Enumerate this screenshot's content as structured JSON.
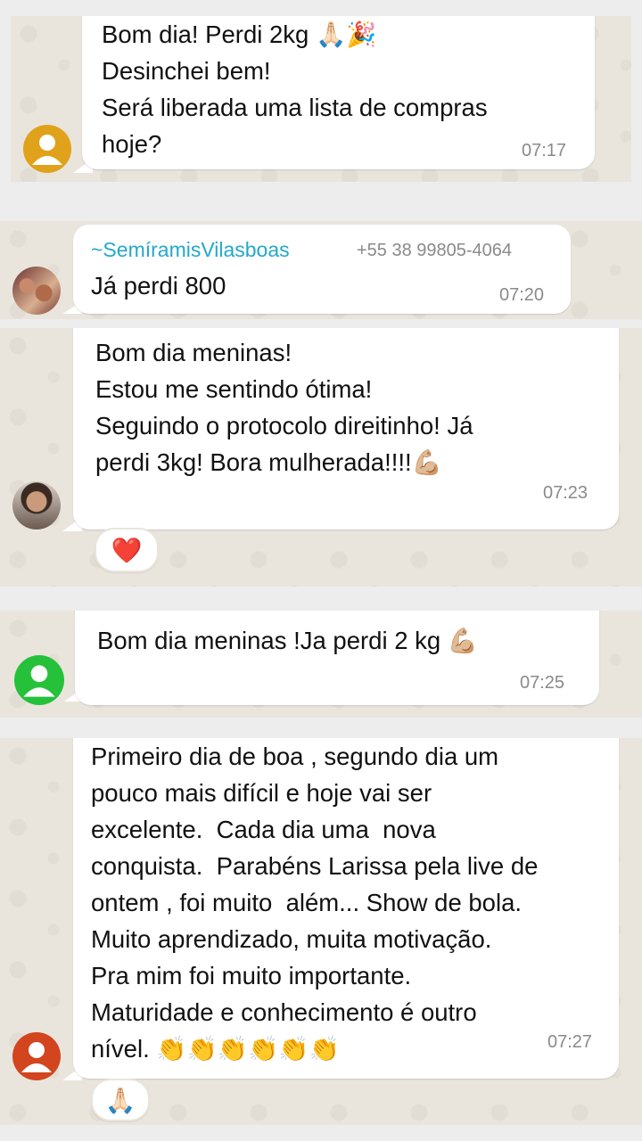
{
  "messages": [
    {
      "lines": [
        "Bom dia! Perdi 2kg 🙏🏻🎉",
        "Desinchei bem!",
        "Será liberada uma lista de compras",
        "hoje?"
      ],
      "time": "07:17"
    },
    {
      "sender": "~SemíramisVilasboas",
      "phone": "+55 38 99805-4064",
      "lines": [
        "Já perdi 800"
      ],
      "time": "07:20"
    },
    {
      "lines": [
        "Bom dia meninas!",
        "Estou me sentindo ótima!",
        "Seguindo o protocolo direitinho! Já",
        "perdi 3kg! Bora mulherada!!!!💪🏼"
      ],
      "time": "07:23",
      "reaction": "❤️"
    },
    {
      "lines": [
        "Bom dia meninas !Ja perdi 2 kg 💪🏼"
      ],
      "time": "07:25"
    },
    {
      "lines": [
        "Primeiro dia de boa , segundo dia um",
        "pouco mais difícil e hoje vai ser",
        "excelente.  Cada dia uma  nova",
        "conquista.  Parabéns Larissa pela live de",
        "ontem , foi muito  além... Show de bola.",
        "Muito aprendizado, muita motivação.",
        "Pra mim foi muito importante.",
        "Maturidade e conhecimento é outro",
        "nível. 👏👏👏👏👏👏"
      ],
      "time": "07:27",
      "reaction": "🙏🏻"
    }
  ],
  "colors": {
    "chat_bg": "#e9e5dd",
    "bubble": "#ffffff",
    "sender_name": "#23a9c9",
    "timestamp": "#8a8a8a",
    "avatar_orange": "#e0a21b",
    "avatar_green": "#25c13a",
    "avatar_red": "#d2451e"
  },
  "icons": [
    "default-avatar-icon",
    "profile-photo"
  ]
}
